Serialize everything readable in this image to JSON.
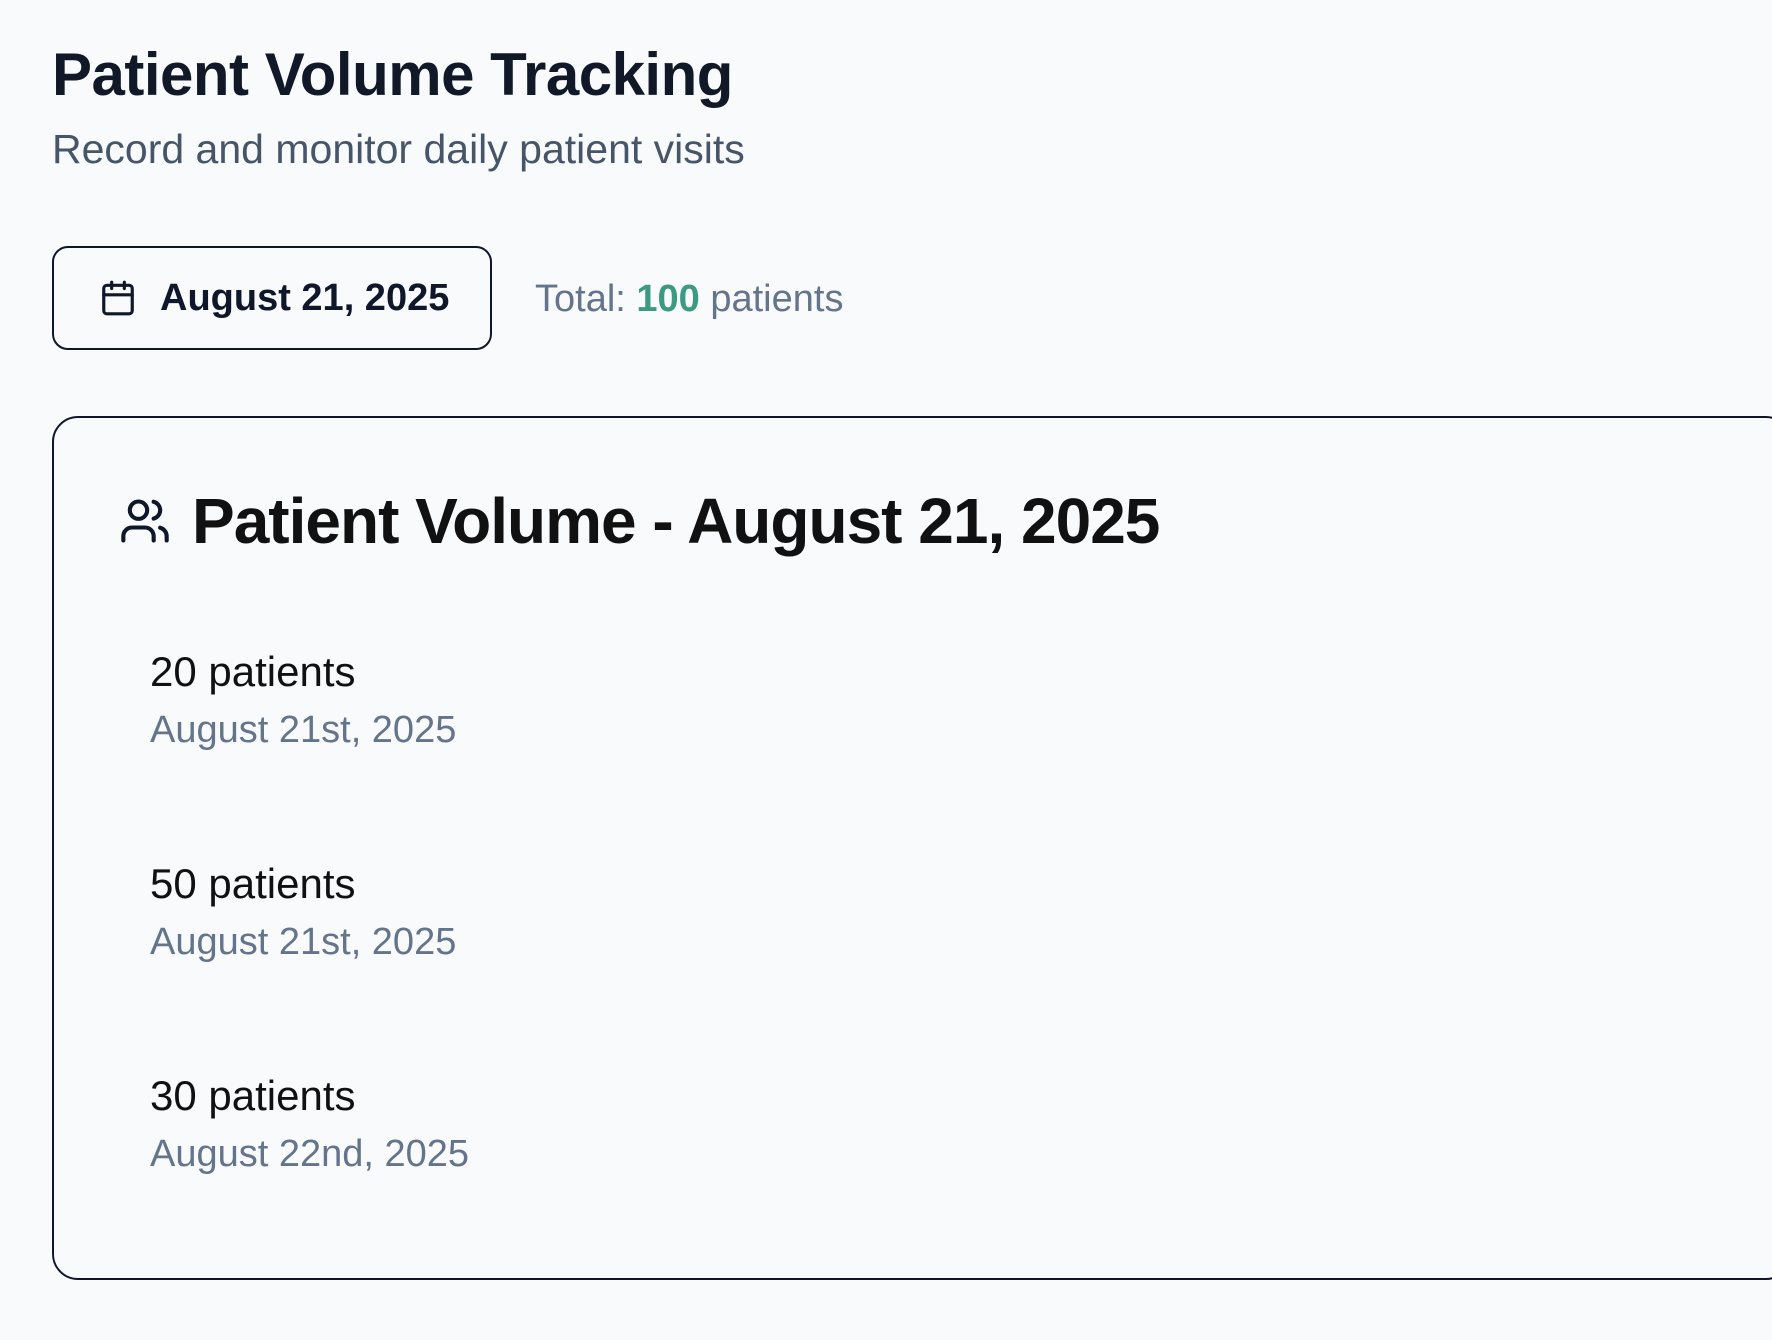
{
  "header": {
    "title": "Patient Volume Tracking",
    "subtitle": "Record and monitor daily patient visits"
  },
  "toolbar": {
    "date_picker": {
      "icon": "calendar-icon",
      "label": "August 21, 2025"
    },
    "total": {
      "prefix": "Total:",
      "count": "100",
      "suffix": "patients"
    }
  },
  "card": {
    "icon": "users-icon",
    "title": "Patient Volume - August 21, 2025",
    "entries": [
      {
        "count_label": "20 patients",
        "date_label": "August 21st, 2025"
      },
      {
        "count_label": "50 patients",
        "date_label": "August 21st, 2025"
      },
      {
        "count_label": "30 patients",
        "date_label": "August 22nd, 2025"
      }
    ]
  },
  "colors": {
    "accent": "#3d9a82",
    "background": "#f8fafc",
    "muted_text": "#64748b",
    "border": "#0f172a"
  }
}
